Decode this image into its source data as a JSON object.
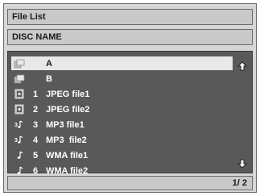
{
  "header": {
    "title": "File List"
  },
  "disc": {
    "name": "DISC NAME"
  },
  "list": {
    "items": [
      {
        "icon": "folder-icon",
        "number": "",
        "name": "A",
        "selected": true
      },
      {
        "icon": "folder-icon",
        "number": "",
        "name": "B",
        "selected": false
      },
      {
        "icon": "jpeg-file-icon",
        "number": "1",
        "name": "JPEG file1",
        "selected": false
      },
      {
        "icon": "jpeg-file-icon",
        "number": "2",
        "name": "JPEG file2",
        "selected": false
      },
      {
        "icon": "mp3-file-icon",
        "number": "3",
        "name": "MP3 file1",
        "selected": false
      },
      {
        "icon": "mp3-file-icon",
        "number": "4",
        "name": "MP3  file2",
        "selected": false
      },
      {
        "icon": "wma-file-icon",
        "number": "5",
        "name": "WMA file1",
        "selected": false
      },
      {
        "icon": "wma-file-icon",
        "number": "6",
        "name": "WMA file2",
        "selected": false
      }
    ]
  },
  "pager": {
    "text": "1/ 2"
  },
  "colors": {
    "list_bg": "#595959",
    "highlight": "#e8e8e8",
    "panel": "#d6d6d6"
  }
}
